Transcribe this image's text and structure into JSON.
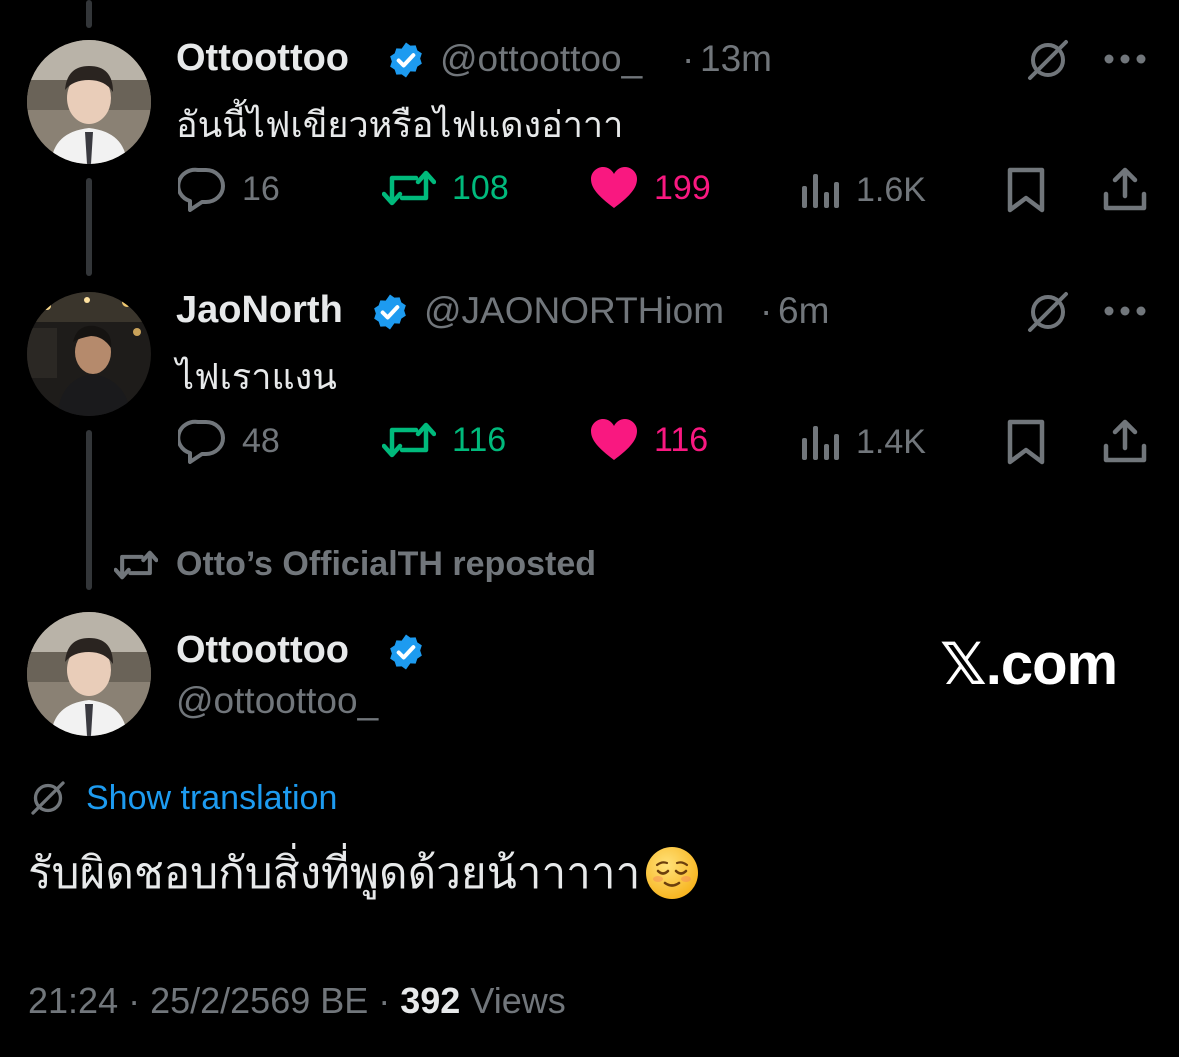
{
  "tweet1": {
    "display_name": "Ottoottoo",
    "handle": "@ottoottoo_",
    "time": "13m",
    "text": "อันนี้ไฟเขียวหรือไฟแดงอ่าาา",
    "replies": "16",
    "reposts": "108",
    "likes": "199",
    "views": "1.6K"
  },
  "tweet2": {
    "display_name": "JaoNorth",
    "handle": "@JAONORTHiom",
    "time": "6m",
    "text": "ไฟเราแงน",
    "replies": "48",
    "reposts": "116",
    "likes": "116",
    "views": "1.4K"
  },
  "repost_banner": "Otto’s OfficialTH reposted",
  "main": {
    "display_name": "Ottoottoo",
    "handle": "@ottoottoo_",
    "watermark": "𝕏.com",
    "show_translation": "Show translation",
    "text": "รับผิดชอบกับสิ่งที่พูดด้วยน้าาาาา",
    "timestamp": "21:24 · 25/2/2569 BE · ",
    "views_count": "392",
    "views_label": " Views"
  },
  "colors": {
    "background": "#000000",
    "text": "#e7e9ea",
    "secondary": "#71767b",
    "repost_green": "#00ba7c",
    "like_pink": "#f91880",
    "link_blue": "#1d9bf0",
    "verified_blue": "#1d9bf0"
  },
  "icons": [
    "reply-icon",
    "repost-icon",
    "heart-icon",
    "views-icon",
    "bookmark-icon",
    "share-icon",
    "translate-icon",
    "more-icon",
    "verified-badge-icon",
    "smiling-emoji"
  ]
}
